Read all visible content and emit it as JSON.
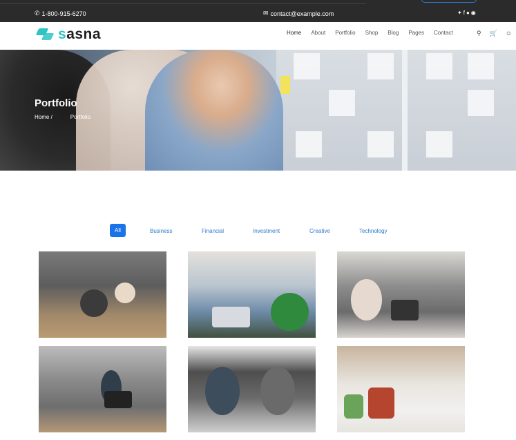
{
  "topbar": {
    "phone": "1-800-915-6270",
    "email": "contact@example.com",
    "social_icons": [
      "twitter-icon",
      "facebook-icon",
      "skype-icon",
      "pinterest-icon"
    ]
  },
  "nav": {
    "logo_text": "sasna",
    "logo_accent_letter": "s",
    "items": [
      {
        "label": "Home",
        "active": true
      },
      {
        "label": "About"
      },
      {
        "label": "Portfolio"
      },
      {
        "label": "Shop"
      },
      {
        "label": "Blog"
      },
      {
        "label": "Pages"
      },
      {
        "label": "Contact"
      }
    ],
    "icons": [
      "search-icon",
      "cart-icon",
      "user-icon"
    ]
  },
  "hero": {
    "title": "Portfolio",
    "breadcrumb": {
      "home": "Home /",
      "current": "Portfolio"
    }
  },
  "filters": {
    "items": [
      "All",
      "Business",
      "Financial",
      "Investment",
      "Creative",
      "Technology"
    ],
    "active": "All"
  },
  "colors": {
    "accent": "#1a73e8",
    "logo_teal": "#2ec4c4",
    "topbar_bg": "#2b2b2b"
  }
}
